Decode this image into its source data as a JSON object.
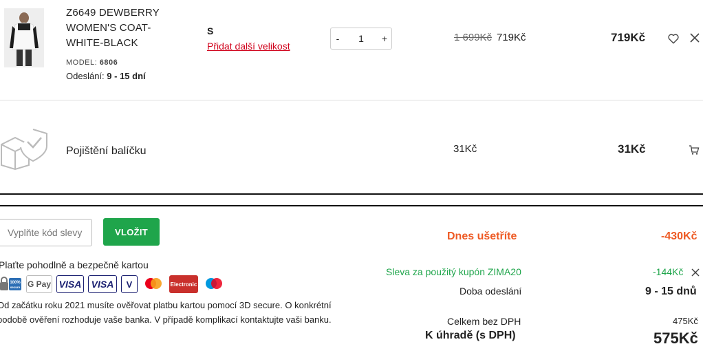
{
  "product": {
    "name": "Z6649 DEWBERRY WOMEN'S COAT-WHITE-BLACK",
    "model_label": "MODEL:",
    "model_value": "6806",
    "shipping_label": "Odeslání:",
    "shipping_value": "9 - 15 dní",
    "size": "S",
    "add_size_link": "Přidat další velikost",
    "qty_minus": "-",
    "qty_value": "1",
    "qty_plus": "+",
    "old_price": "1 699Kč",
    "price": "719Kč",
    "total": "719Kč"
  },
  "insurance": {
    "label": "Pojištění balíčku",
    "price": "31Kč",
    "total": "31Kč"
  },
  "coupon": {
    "placeholder": "Vyplňte kód slevy",
    "button_label": "VLOŽIT"
  },
  "payment": {
    "title": "Plaťte pohodlně a bezpečně kartou",
    "cards": [
      "100% secure",
      "G Pay",
      "VISA",
      "VISA Electron",
      "V Pay",
      "mastercard",
      "Maestro Electronic",
      "maestro"
    ],
    "notice": "Od začátku roku 2021 musíte ověřovat platbu kartou pomocí 3D secure. O konkrétní podobě ověření rozhoduje vaše banka. V případě komplikací kontaktujte vaši banku."
  },
  "summary": {
    "savings_label": "Dnes ušetříte",
    "savings_value": "-430Kč",
    "coupon_label": "Sleva za použitý kupón ZIMA20",
    "coupon_value": "-144Kč",
    "shipping_label": "Doba odeslání",
    "shipping_value": "9 - 15 dnů",
    "net_label": "Celkem bez DPH",
    "net_value": "475Kč",
    "total_label": "K úhradě (s DPH)",
    "total_value": "575Kč"
  },
  "colors": {
    "accent_green": "#1fa54b",
    "savings_orange": "#ee5a24",
    "link_red": "#d0021b"
  }
}
